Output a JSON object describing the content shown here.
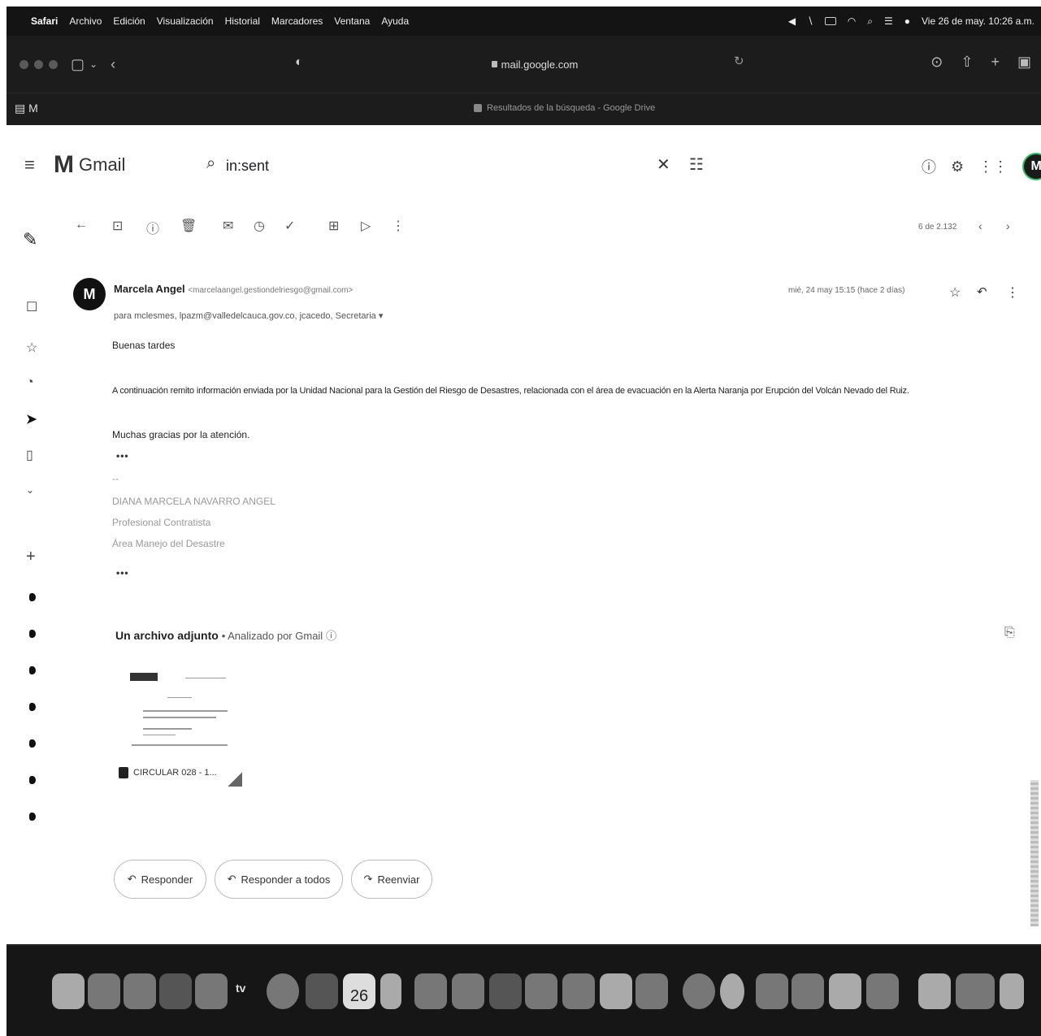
{
  "menubar": {
    "app": "Safari",
    "items": [
      "Archivo",
      "Edición",
      "Visualización",
      "Historial",
      "Marcadores",
      "Ventana",
      "Ayuda"
    ],
    "clock": "Vie 26 de may. 10:26 a.m."
  },
  "safari": {
    "url": "mail.google.com",
    "tab_title": "Resultados de la búsqueda - Google Drive"
  },
  "gmail": {
    "logo_text": "Gmail",
    "search_value": "in:sent",
    "pager": "6 de 2.132"
  },
  "message": {
    "sender_name": "Marcela Angel",
    "sender_email": "<marcelaangel.gestiondelriesgo@gmail.com>",
    "recipients": "para mclesmes, lpazm@valledelcauca.gov.co, jcacedo, Secretaria",
    "date": "mié, 24 may 15:15 (hace 2 días)",
    "greeting": "Buenas tardes",
    "body": "A continuación remito información enviada por la Unidad Nacional para la Gestión del Riesgo de Desastres, relacionada con el área de evacuación en la Alerta Naranja por Erupción del Volcán Nevado del Ruiz.",
    "thanks": "Muchas gracias por la atención.",
    "ellipsis": "•••",
    "sig_dash": "--",
    "sig_name": "DIANA MARCELA NAVARRO ANGEL",
    "sig_role": "Profesional Contratista",
    "sig_area": "Área Manejo del Desastre"
  },
  "attachment": {
    "header": "Un archivo adjunto",
    "scanned": "Analizado por Gmail",
    "filename": "CIRCULAR 028 - 1..."
  },
  "actions": {
    "reply": "Responder",
    "reply_all": "Responder a todos",
    "forward": "Reenviar"
  },
  "dock": {
    "tv_label": "tv",
    "calendar_day": "26"
  }
}
